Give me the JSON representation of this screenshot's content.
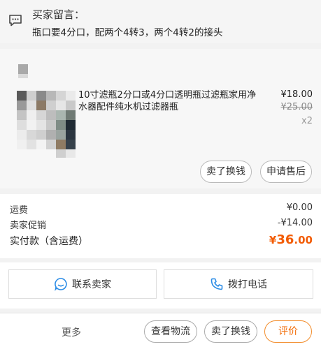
{
  "buyer_memo": {
    "label": "买家留言：",
    "text": "瓶口要4分口，配两个4转3，两个4转2的接头",
    "icon": "message-icon"
  },
  "item": {
    "title": "10寸滤瓶2分口或4分口透明瓶过滤瓶家用净水器配件纯水机过滤器瓶",
    "price": "¥18.00",
    "original_price": "¥25.00",
    "quantity": "x2",
    "actions": [
      "卖了换钱",
      "申请售后"
    ]
  },
  "summary": {
    "shipping_label": "运费",
    "shipping_value": "¥0.00",
    "promo_label": "卖家促销",
    "promo_value": "-¥14.00",
    "paid_label": "实付款（含运费）",
    "paid_currency": "¥",
    "paid_integer": "36",
    "paid_decimal": ".00",
    "accent_color": "#f25c05"
  },
  "contacts": {
    "seller_label": "联系卖家",
    "seller_icon": "chat-bubble-icon",
    "call_label": "拨打电话",
    "call_icon": "phone-icon",
    "icon_color": "#2b8ce6"
  },
  "footer": {
    "more": "更多",
    "logistics": "查看物流",
    "resell": "卖了换钱",
    "review": "评价"
  }
}
